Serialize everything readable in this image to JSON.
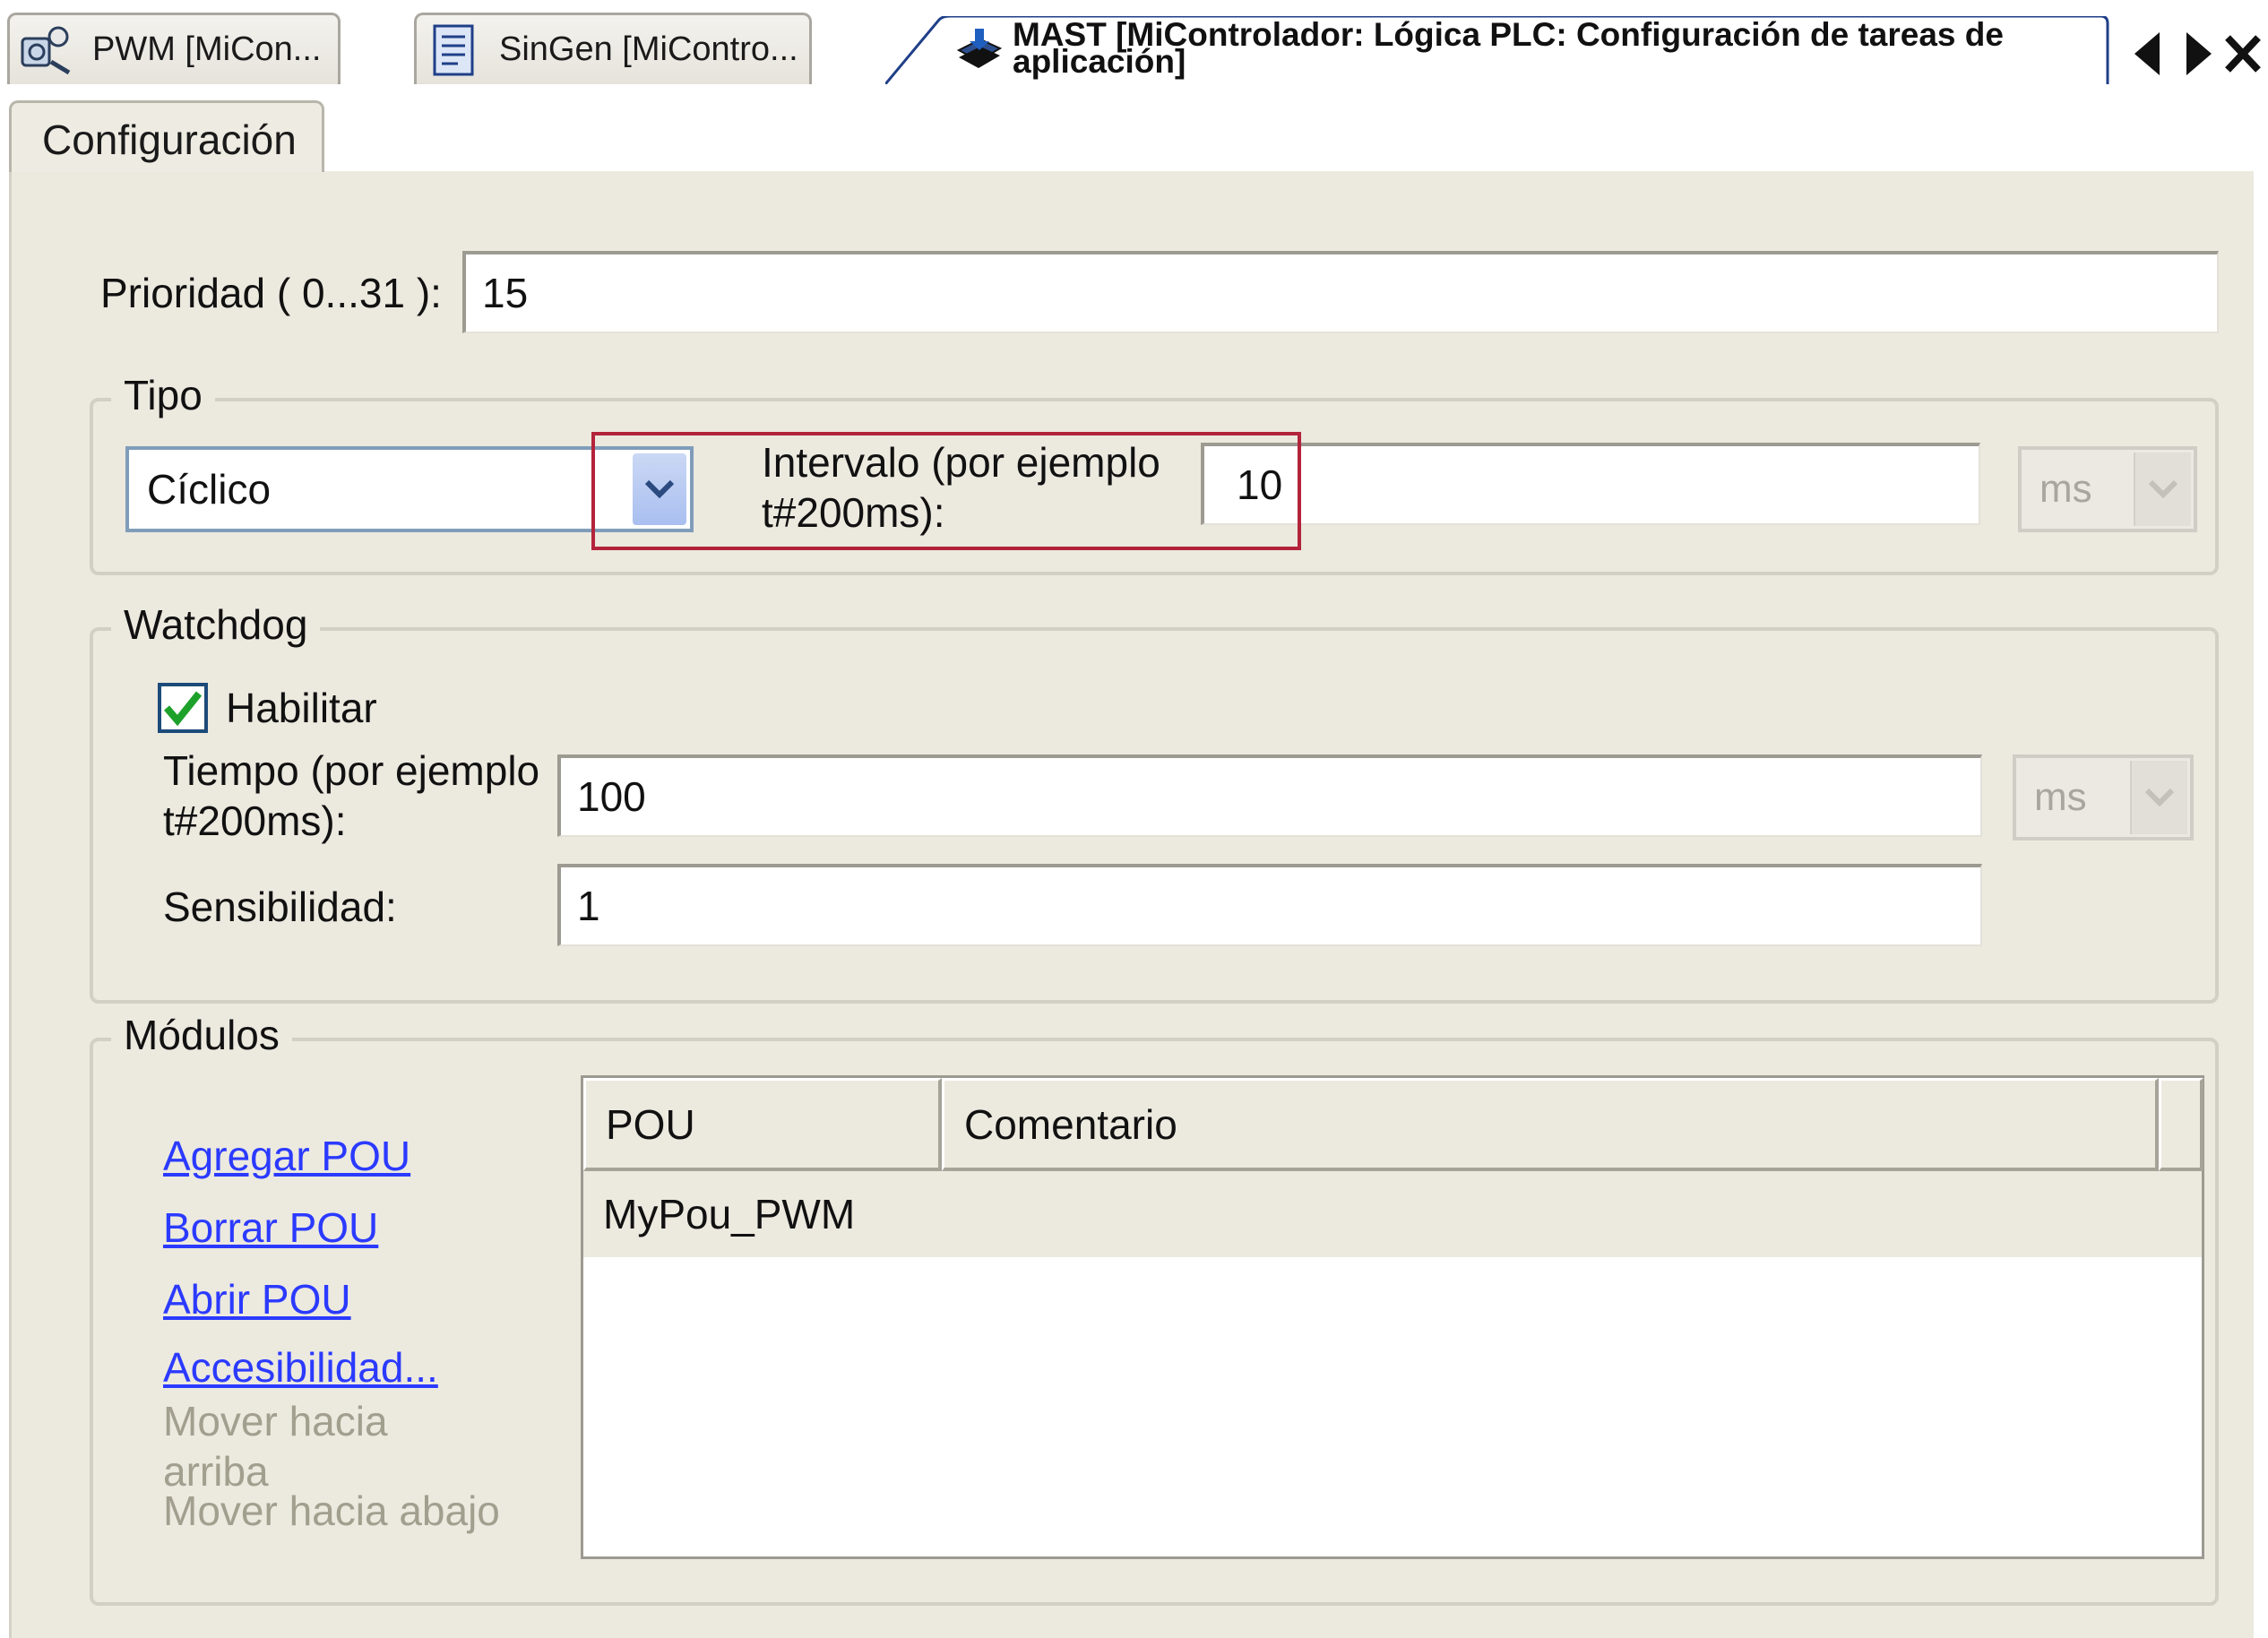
{
  "doc_tabs": [
    {
      "label": "PWM [MiCon...",
      "icon": "pwm-config-icon"
    },
    {
      "label": "SinGen [MiContro...",
      "icon": "function-block-icon"
    }
  ],
  "active_tab": {
    "label": "MAST [MiControlador: Lógica PLC: Configuración de tareas de aplicación]",
    "icon": "task-icon"
  },
  "sub_tab": "Configuración",
  "priority": {
    "label": "Prioridad ( 0...31 ):",
    "value": "15"
  },
  "tipo": {
    "title": "Tipo",
    "type_value": "Cíclico",
    "interval_label_1": "Intervalo (por ejemplo",
    "interval_label_2": "t#200ms):",
    "interval_value": "10",
    "unit": "ms"
  },
  "watchdog": {
    "title": "Watchdog",
    "enable_label": "Habilitar",
    "enabled": true,
    "time_label_1": "Tiempo (por ejemplo",
    "time_label_2": "t#200ms):",
    "time_value": "100",
    "unit": "ms",
    "sensitivity_label": "Sensibilidad:",
    "sensitivity_value": "1"
  },
  "modules": {
    "title": "Módulos",
    "actions": [
      "Agregar POU",
      "Borrar POU",
      "Abrir POU",
      "Accesibilidad..."
    ],
    "move_up_1": "Mover hacia",
    "move_up_2": "arriba",
    "move_down": "Mover hacia abajo",
    "columns": [
      "POU",
      "Comentario"
    ],
    "rows": [
      {
        "pou": "MyPou_PWM",
        "comment": ""
      }
    ]
  },
  "colors": {
    "highlight": "#b3243b",
    "link": "#2b3aff",
    "panel": "#ece9df"
  }
}
